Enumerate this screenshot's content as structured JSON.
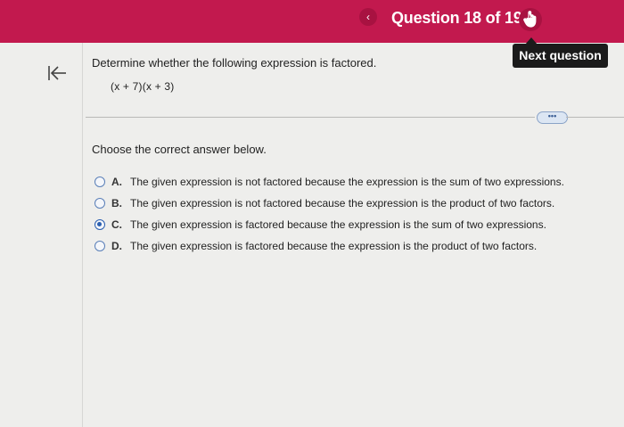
{
  "header": {
    "prev_icon": "chevron-left-icon",
    "question_counter": "Question 18 of 19",
    "next_icon": "hand-pointer-icon"
  },
  "tooltip": {
    "label": "Next question"
  },
  "back_icon": "first-page-arrow-icon",
  "question": {
    "prompt": "Determine whether the following expression is factored.",
    "expression": "(x + 7)(x + 3)",
    "more_label": "•••",
    "instruction": "Choose the correct answer below."
  },
  "options": [
    {
      "letter": "A.",
      "text": "The given expression is not factored because the expression is the sum of two expressions.",
      "selected": false
    },
    {
      "letter": "B.",
      "text": "The given expression is not factored because the expression is the product of two factors.",
      "selected": false
    },
    {
      "letter": "C.",
      "text": "The given expression is factored because the expression is the sum of two expressions.",
      "selected": true
    },
    {
      "letter": "D.",
      "text": "The given expression is factored because the expression is the product of two factors.",
      "selected": false
    }
  ],
  "colors": {
    "header_bg": "#c2194e",
    "radio": "#2b5fb0",
    "page_bg": "#eeeeec"
  }
}
